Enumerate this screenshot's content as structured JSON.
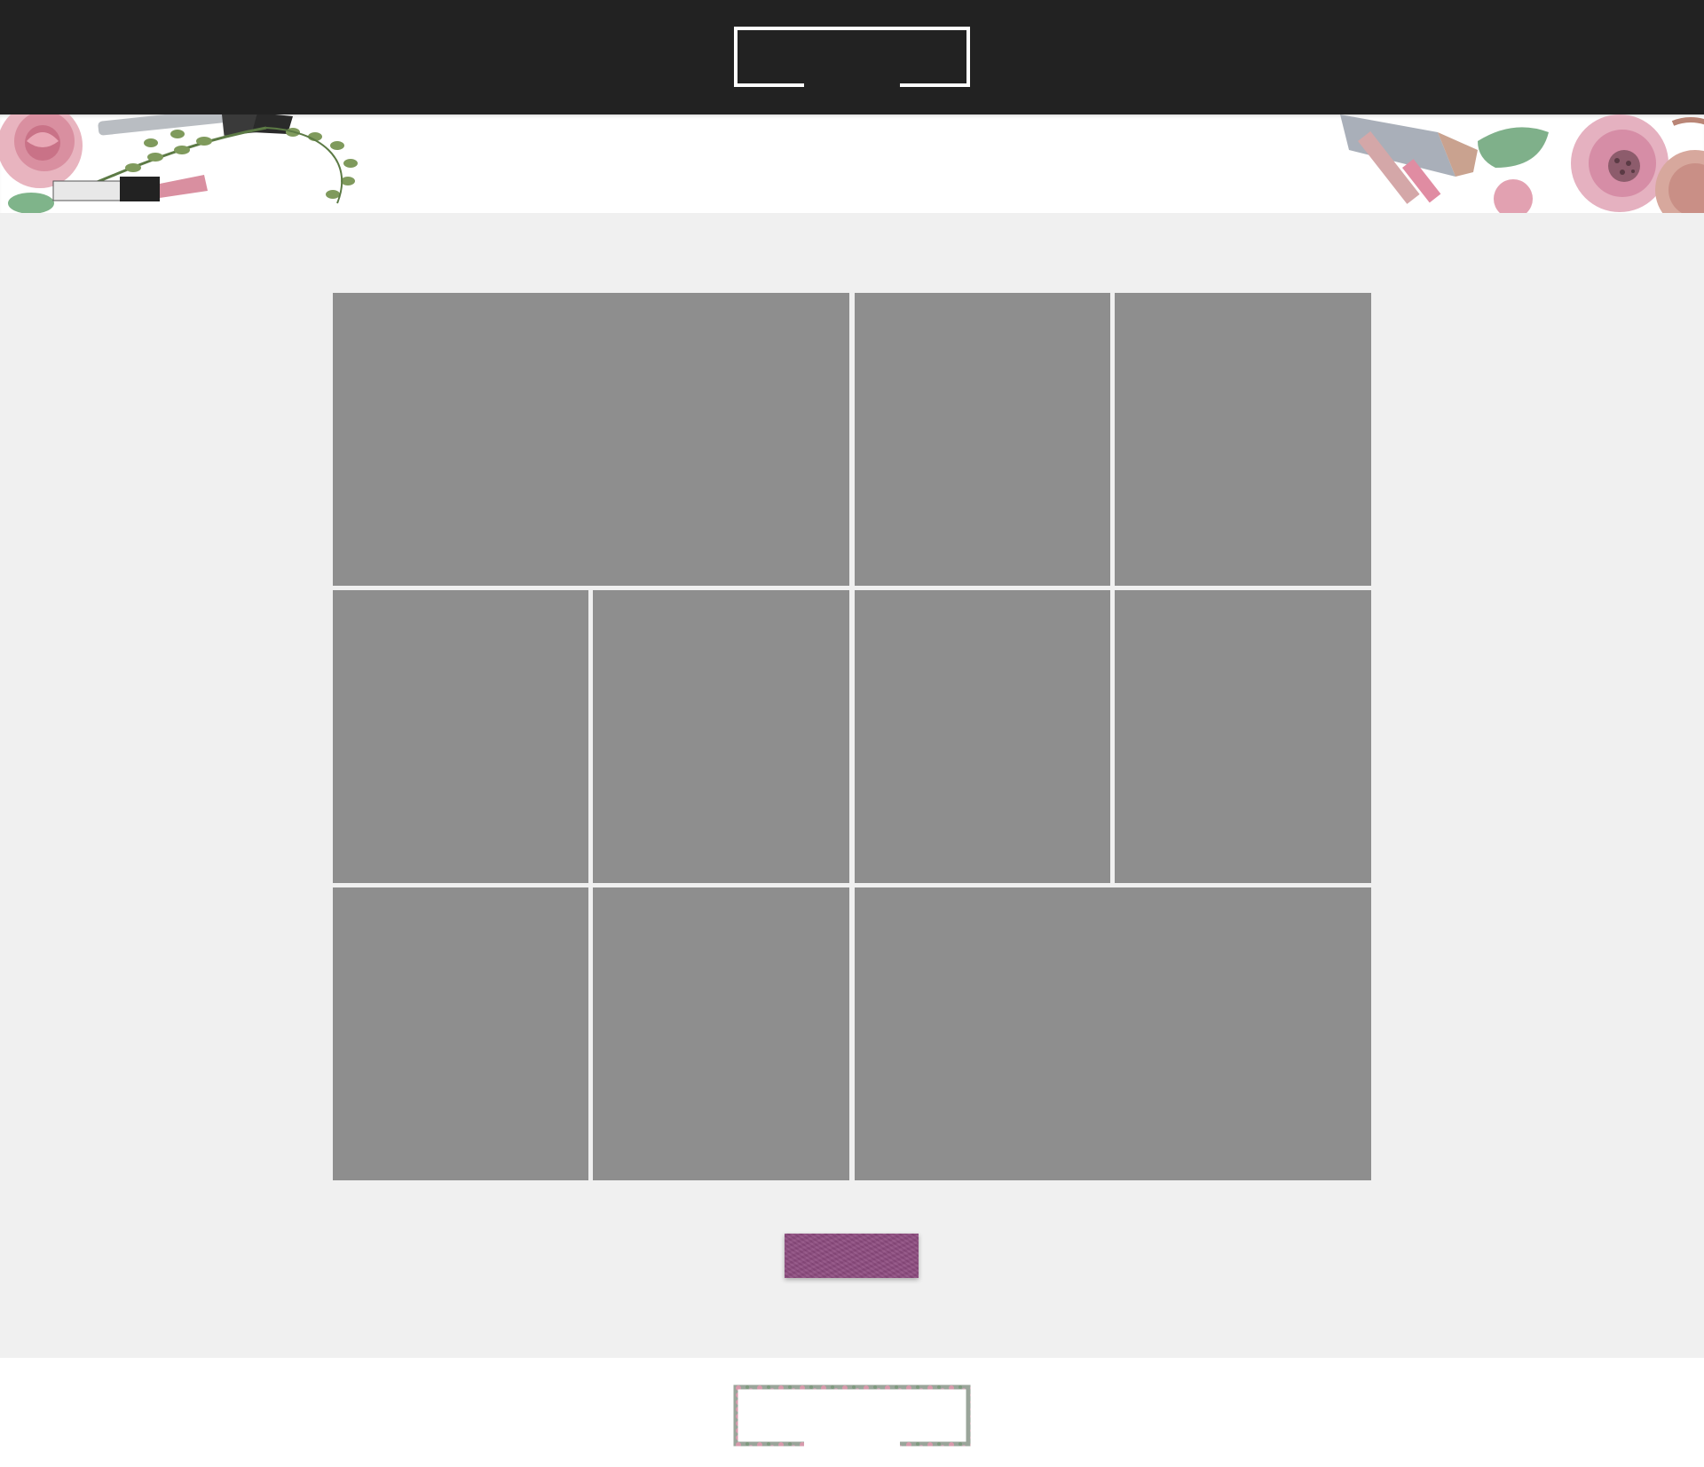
{
  "header": {
    "logo": {
      "icon": "logo-frame-icon",
      "stroke_color": "#ffffff"
    },
    "background_color": "#222222"
  },
  "banner": {
    "left_art": "floral-makeup-left",
    "right_art": "floral-makeup-right"
  },
  "gallery": {
    "tile_color": "#8e8e8e",
    "tiles": [
      {
        "id": "tile-1",
        "kind": "image-placeholder"
      },
      {
        "id": "tile-2",
        "kind": "image-placeholder"
      },
      {
        "id": "tile-3",
        "kind": "image-placeholder"
      },
      {
        "id": "tile-4",
        "kind": "image-placeholder"
      },
      {
        "id": "tile-5",
        "kind": "image-placeholder"
      },
      {
        "id": "tile-6",
        "kind": "image-placeholder"
      },
      {
        "id": "tile-7",
        "kind": "image-placeholder"
      },
      {
        "id": "tile-8",
        "kind": "image-placeholder"
      },
      {
        "id": "tile-9",
        "kind": "image-placeholder"
      },
      {
        "id": "tile-10",
        "kind": "image-placeholder"
      }
    ]
  },
  "more_button": {
    "label": "",
    "color": "#8e4c80"
  },
  "footer": {
    "logo": {
      "icon": "floral-logo-frame-icon"
    }
  }
}
